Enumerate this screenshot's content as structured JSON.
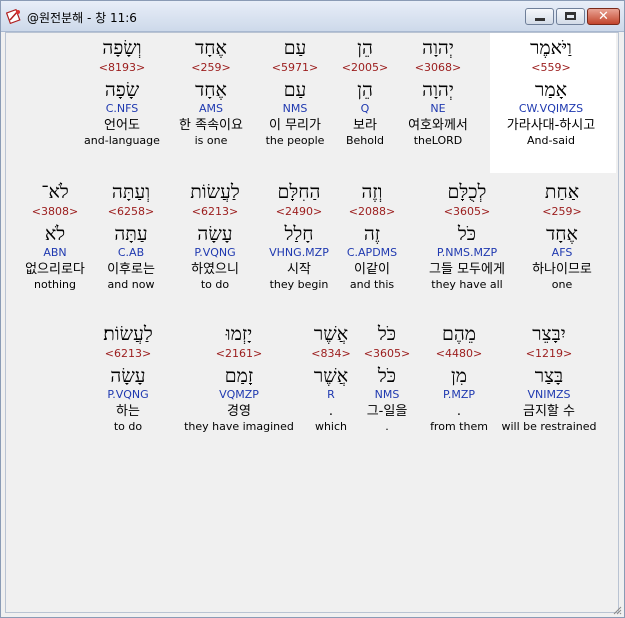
{
  "window": {
    "title": "@원전분해 - 창 11:6",
    "icon": "app-bible-icon",
    "buttons": [
      "minimize",
      "maximize",
      "close"
    ],
    "close_label": "✕"
  },
  "rows": [
    [
      {
        "heb": "וַיֹּאמֶר",
        "num": "<559>",
        "lemma": "אָמַר",
        "code": "CW.VQIMZS",
        "kor": "가라사대-하시고",
        "eng": "And-said",
        "highlight": true
      },
      {
        "heb": "יְהוָה",
        "num": "<3068>",
        "lemma": "יְהוָה",
        "code": "NE",
        "kor": "여호와께서",
        "eng": "theLORD"
      },
      {
        "heb": "הֵן",
        "num": "<2005>",
        "lemma": "הֵן",
        "code": "Q",
        "kor": "보라",
        "eng": "Behold"
      },
      {
        "heb": "עַם",
        "num": "<5971>",
        "lemma": "עַם",
        "code": "NMS",
        "kor": "이 무리가",
        "eng": "the people"
      },
      {
        "heb": "אֶחָד",
        "num": "<259>",
        "lemma": "אֶחָד",
        "code": "AMS",
        "kor": "한 족속이요",
        "eng": "is one"
      },
      {
        "heb": "וְשָׂפָה",
        "num": "<8193>",
        "lemma": "שָׂפָה",
        "code": "C.NFS",
        "kor": "언어도",
        "eng": "and-language"
      }
    ],
    [
      {
        "heb": "אַחַת",
        "num": "<259>",
        "lemma": "אֶחָד",
        "code": "AFS",
        "kor": "하나이므로",
        "eng": "one"
      },
      {
        "heb": "לְכֻלָּם",
        "num": "<3605>",
        "lemma": "כֹּל",
        "code": "P.NMS.MZP",
        "kor": "그들 모두에게",
        "eng": "they have all"
      },
      {
        "heb": "וְזֶה",
        "num": "<2088>",
        "lemma": "זֶה",
        "code": "C.APDMS",
        "kor": "이같이",
        "eng": "and this"
      },
      {
        "heb": "הַחִלָּם",
        "num": "<2490>",
        "lemma": "חָלַל",
        "code": "VHNG.MZP",
        "kor": "시작",
        "eng": "they begin"
      },
      {
        "heb": "לַעֲשׂוֹת",
        "num": "<6213>",
        "lemma": "עָשָׂה",
        "code": "P.VQNG",
        "kor": "하였으니",
        "eng": "to do"
      },
      {
        "heb": "וְעַתָּה",
        "num": "<6258>",
        "lemma": "עַתָּה",
        "code": "C.AB",
        "kor": "이후로는",
        "eng": "and now"
      },
      {
        "heb": "לֹא־",
        "num": "<3808>",
        "lemma": "לֹא",
        "code": "ABN",
        "kor": "없으리로다",
        "eng": "nothing"
      }
    ],
    [
      {
        "heb": "יִבָּצֵר",
        "num": "<1219>",
        "lemma": "בָּצַר",
        "code": "VNIMZS",
        "kor": "금지할 수",
        "eng": "will be restrained"
      },
      {
        "heb": "מֵהֶם",
        "num": "<4480>",
        "lemma": "מִן",
        "code": "P.MZP",
        "kor": ".",
        "eng": "from them"
      },
      {
        "heb": "כֹּל",
        "num": "<3605>",
        "lemma": "כֹּל",
        "code": "NMS",
        "kor": "그-일을",
        "eng": "."
      },
      {
        "heb": "אֲשֶׁר",
        "num": "<834>",
        "lemma": "אֲשֶׁר",
        "code": "R",
        "kor": ".",
        "eng": "which"
      },
      {
        "heb": "יָזְמוּ",
        "num": "<2161>",
        "lemma": "זָמַם",
        "code": "VQMZP",
        "kor": "경영",
        "eng": "they have imagined"
      },
      {
        "heb": "לַעֲשׂוֹת׃",
        "num": "<6213>",
        "lemma": "עָשָׂה",
        "code": "P.VQNG",
        "kor": "하는",
        "eng": "to do"
      }
    ]
  ]
}
